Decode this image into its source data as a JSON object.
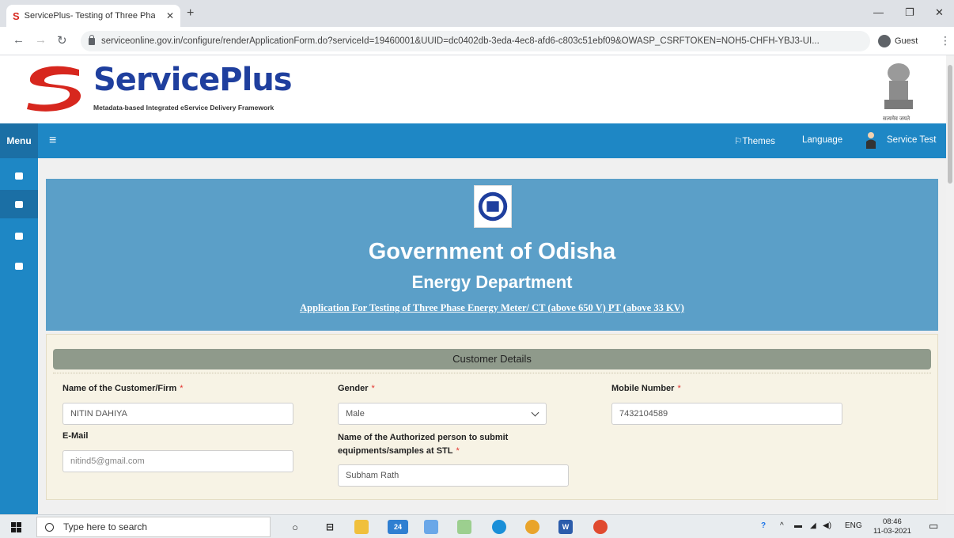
{
  "browser": {
    "tab_title": "ServicePlus- Testing of Three Pha",
    "url": "serviceonline.gov.in/configure/renderApplicationForm.do?serviceId=19460001&UUID=dc0402db-3eda-4ec8-afd6-c803c51ebf09&OWASP_CSRFTOKEN=NOH5-CHFH-YBJ3-UI...",
    "profile_label": "Guest"
  },
  "header": {
    "brand": "ServicePlus",
    "tagline": "Metadata-based Integrated eService Delivery Framework",
    "emblem_caption": "सत्यमेव जयते"
  },
  "topnav": {
    "menu_label": "Menu",
    "themes_label": "Themes",
    "language_label": "Language",
    "user_label": "Service Test"
  },
  "banner": {
    "government": "Government of Odisha",
    "department": "Energy Department",
    "application_title": "Application For Testing of Three Phase Energy Meter/ CT (above 650 V) PT (above 33 KV)"
  },
  "form": {
    "section_title": "Customer Details",
    "fields": {
      "customer_name": {
        "label": "Name of the Customer/Firm",
        "required": "*",
        "value": "NITIN DAHIYA"
      },
      "gender": {
        "label": "Gender",
        "required": "*",
        "value": "Male"
      },
      "mobile": {
        "label": "Mobile Number",
        "required": "*",
        "value": "7432104589"
      },
      "email": {
        "label": "E-Mail",
        "value": "nitind5@gmail.com"
      },
      "authorized_person": {
        "label_line1": "Name of the Authorized person to submit",
        "label_line2": "equipments/samples at STL",
        "required": "*",
        "value": "Subham Rath"
      }
    }
  },
  "taskbar": {
    "search_placeholder": "Type here to search",
    "mail_badge": "24",
    "language": "ENG",
    "time": "08:46",
    "date": "11-03-2021"
  },
  "colors": {
    "nav_blue": "#1e87c5",
    "banner_blue": "#5b9fc8",
    "section_header": "#8f9a8b",
    "brand_blue": "#1f3f9e",
    "brand_red": "#d7271e"
  }
}
